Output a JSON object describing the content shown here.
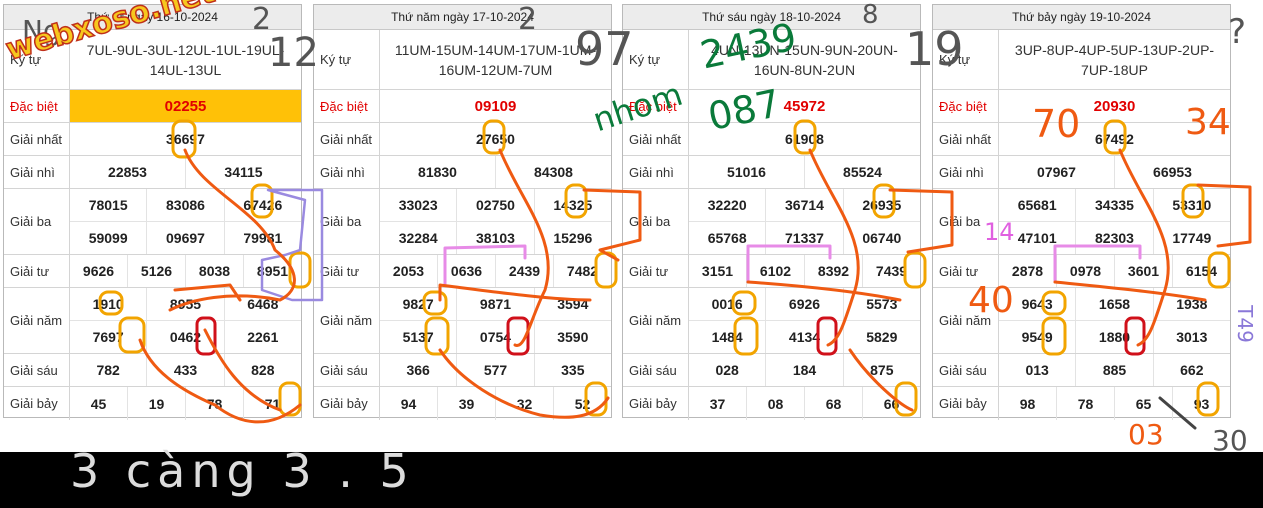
{
  "watermark": "webxoso.net",
  "panels": [
    {
      "date": "Thứ tư ngày 16-10-2024",
      "kytu_label": "Ký tự",
      "kytu": "7UL-9UL-3UL-12UL-1UL-19UL-14UL-13UL",
      "special_highlight": true,
      "rows": [
        {
          "label": "Đặc biệt",
          "type": "special",
          "lines": [
            [
              "02255"
            ]
          ]
        },
        {
          "label": "Giải nhất",
          "lines": [
            [
              "36697"
            ]
          ]
        },
        {
          "label": "Giải nhì",
          "lines": [
            [
              "22853",
              "34115"
            ]
          ]
        },
        {
          "label": "Giải ba",
          "lines": [
            [
              "78015",
              "83086",
              "67426"
            ],
            [
              "59099",
              "09697",
              "79981"
            ]
          ]
        },
        {
          "label": "Giải tư",
          "lines": [
            [
              "9626",
              "5126",
              "8038",
              "8951"
            ]
          ]
        },
        {
          "label": "Giải năm",
          "lines": [
            [
              "1910",
              "8955",
              "6468"
            ],
            [
              "7697",
              "0462",
              "2261"
            ]
          ]
        },
        {
          "label": "Giải sáu",
          "lines": [
            [
              "782",
              "433",
              "828"
            ]
          ]
        },
        {
          "label": "Giải bảy",
          "lines": [
            [
              "45",
              "19",
              "78",
              "71"
            ]
          ]
        }
      ]
    },
    {
      "date": "Thứ năm ngày 17-10-2024",
      "kytu_label": "Ký tự",
      "kytu": "11UM-15UM-14UM-17UM-1UM-16UM-12UM-7UM",
      "special_highlight": false,
      "rows": [
        {
          "label": "Đặc biệt",
          "type": "special",
          "lines": [
            [
              "09109"
            ]
          ]
        },
        {
          "label": "Giải nhất",
          "lines": [
            [
              "27650"
            ]
          ]
        },
        {
          "label": "Giải nhì",
          "lines": [
            [
              "81830",
              "84308"
            ]
          ]
        },
        {
          "label": "Giải ba",
          "lines": [
            [
              "33023",
              "02750",
              "14325"
            ],
            [
              "32284",
              "38103",
              "15296"
            ]
          ]
        },
        {
          "label": "Giải tư",
          "lines": [
            [
              "2053",
              "0636",
              "2439",
              "7482"
            ]
          ]
        },
        {
          "label": "Giải năm",
          "lines": [
            [
              "9827",
              "9871",
              "3594"
            ],
            [
              "5137",
              "0754",
              "3590"
            ]
          ]
        },
        {
          "label": "Giải sáu",
          "lines": [
            [
              "366",
              "577",
              "335"
            ]
          ]
        },
        {
          "label": "Giải bảy",
          "lines": [
            [
              "94",
              "39",
              "32",
              "52"
            ]
          ]
        }
      ]
    },
    {
      "date": "Thứ sáu ngày 18-10-2024",
      "kytu_label": "Ký tự",
      "kytu": "4UN-13UN-15UN-9UN-20UN-16UN-8UN-2UN",
      "special_highlight": false,
      "rows": [
        {
          "label": "Đặc biệt",
          "type": "special",
          "lines": [
            [
              "45972"
            ]
          ]
        },
        {
          "label": "Giải nhất",
          "lines": [
            [
              "61908"
            ]
          ]
        },
        {
          "label": "Giải nhì",
          "lines": [
            [
              "51016",
              "85524"
            ]
          ]
        },
        {
          "label": "Giải ba",
          "lines": [
            [
              "32220",
              "36714",
              "26935"
            ],
            [
              "65768",
              "71337",
              "06740"
            ]
          ]
        },
        {
          "label": "Giải tư",
          "lines": [
            [
              "3151",
              "6102",
              "8392",
              "7439"
            ]
          ]
        },
        {
          "label": "Giải năm",
          "lines": [
            [
              "0016",
              "6926",
              "5573"
            ],
            [
              "1484",
              "4134",
              "5829"
            ]
          ]
        },
        {
          "label": "Giải sáu",
          "lines": [
            [
              "028",
              "184",
              "875"
            ]
          ]
        },
        {
          "label": "Giải bảy",
          "lines": [
            [
              "37",
              "08",
              "68",
              "66"
            ]
          ]
        }
      ]
    },
    {
      "date": "Thứ bảy ngày 19-10-2024",
      "kytu_label": "Ký tự",
      "kytu": "3UP-8UP-4UP-5UP-13UP-2UP-7UP-18UP",
      "special_highlight": false,
      "rows": [
        {
          "label": "Đặc biệt",
          "type": "special",
          "lines": [
            [
              "20930"
            ]
          ]
        },
        {
          "label": "Giải nhất",
          "lines": [
            [
              "67492"
            ]
          ]
        },
        {
          "label": "Giải nhì",
          "lines": [
            [
              "07967",
              "66953"
            ]
          ]
        },
        {
          "label": "Giải ba",
          "lines": [
            [
              "65681",
              "34335",
              "53310"
            ],
            [
              "47101",
              "82303",
              "17749"
            ]
          ]
        },
        {
          "label": "Giải tư",
          "lines": [
            [
              "2878",
              "0978",
              "3601",
              "6154"
            ]
          ]
        },
        {
          "label": "Giải năm",
          "lines": [
            [
              "9643",
              "1658",
              "1938"
            ],
            [
              "9549",
              "1880",
              "3013"
            ]
          ]
        },
        {
          "label": "Giải sáu",
          "lines": [
            [
              "013",
              "885",
              "662"
            ]
          ]
        },
        {
          "label": "Giải bảy",
          "lines": [
            [
              "98",
              "78",
              "65",
              "93"
            ]
          ]
        }
      ]
    }
  ],
  "handwritten": {
    "ng": "Ng",
    "n2a": "2",
    "n12": "12",
    "n2b": "2",
    "n97": "97",
    "n8": "8",
    "n19": "19",
    "q": "?",
    "n2439": "2439",
    "n087": "087",
    "nhom": "nhom",
    "n70": "70",
    "n34": "34",
    "n14": "14",
    "n40": "40",
    "t49": "T49",
    "n03": "03",
    "n30": "30",
    "bottom": "3 càng  3 . 5"
  },
  "colors": {
    "special_red": "#e10000",
    "highlight": "#ffc107",
    "annot_orange": "#ef5a12",
    "annot_yellow": "#f2a400",
    "annot_red": "#d0101a",
    "annot_green": "#0a7a3a",
    "annot_pink": "#e78be7",
    "annot_purple": "#9a8ae0"
  }
}
